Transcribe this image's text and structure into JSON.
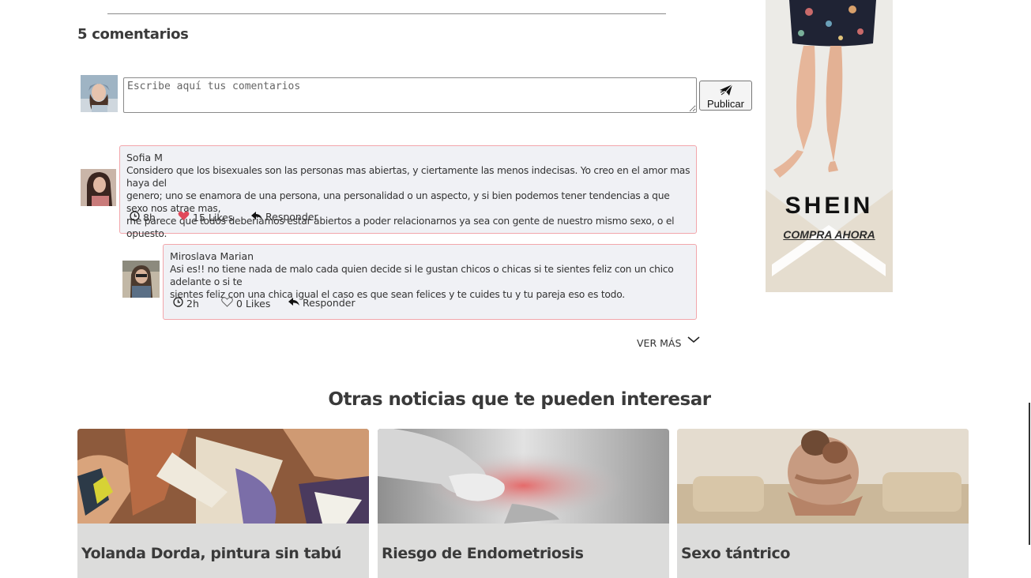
{
  "comments_section": {
    "count_label": "5 comentarios",
    "input_placeholder": "Escribe aquí tus comentarios",
    "publish_label": "Publicar"
  },
  "comments": [
    {
      "author": "Sofia M",
      "text_lines": [
        "Considero que los bisexuales son las personas mas abiertas, y ciertamente las menos indecisas. Yo creo en el amor mas haya del",
        "genero; uno se enamora de una persona, una personalidad o un aspecto, y si bien podemos tener tendencias a que sexo nos atrae mas,",
        "me parece que todos deberiamos estar abiertos a poder relacionarnos ya sea con gente de nuestro mismo sexo, o el opuesto."
      ],
      "time": "8h",
      "likes": "15 Likes",
      "liked": true,
      "reply_label": "Responder"
    },
    {
      "author": "Miroslava Marian",
      "text_lines": [
        "Asi es!! no tiene nada de malo cada quien decide si le gustan chicos o chicas si te sientes feliz con un chico adelante o si te",
        "sientes feliz con una chica igual el caso es que sean felices y te cuides tu y tu pareja eso es todo."
      ],
      "time": "2h",
      "likes": "0 Likes",
      "liked": false,
      "reply_label": "Responder"
    }
  ],
  "ver_mas_label": "VER MÁS",
  "related": {
    "heading": "Otras noticias que te pueden interesar",
    "cards": [
      {
        "title": "Yolanda Dorda, pintura sin tabú"
      },
      {
        "title": "Riesgo de Endometriosis"
      },
      {
        "title": "Sexo tántrico"
      }
    ]
  },
  "ad": {
    "brand": "SHEIN",
    "cta": "COMPRA AHORA"
  },
  "colors": {
    "comment_bg": "#f0f1f5",
    "comment_border": "#f2a6ab",
    "heart": "#e0485a",
    "card_bg": "#dcdcdb"
  }
}
